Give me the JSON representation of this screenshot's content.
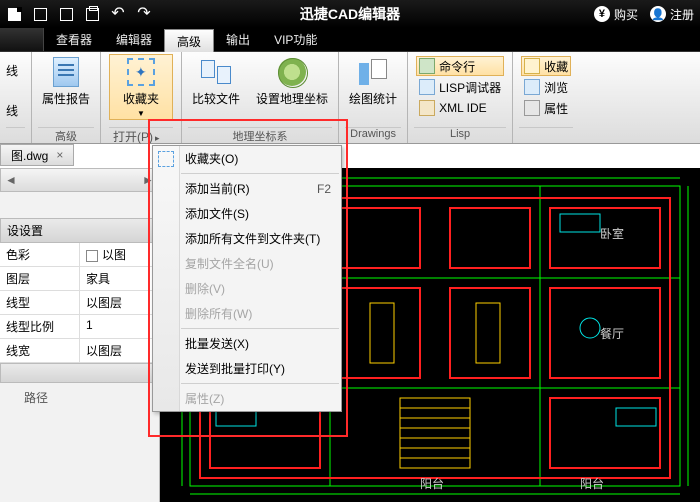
{
  "titlebar": {
    "app_name": "迅捷CAD编辑器",
    "buy": "购买",
    "register": "注册"
  },
  "tabs": {
    "viewer": "查看器",
    "editor": "编辑器",
    "advanced": "高级",
    "output": "输出",
    "vip": "VIP功能"
  },
  "ribbon": {
    "left_stub_top": "线",
    "left_stub_bot": "线",
    "group_adv": {
      "report": "属性报告",
      "foot": "高级"
    },
    "group_fav": {
      "fav": "收藏夹",
      "open": "打开(P)"
    },
    "group_geo": {
      "compare": "比较文件",
      "setgeo": "设置地理坐标",
      "foot": "地理坐标系"
    },
    "group_draw": {
      "stat": "绘图统计",
      "foot": "Drawings"
    },
    "group_lisp": {
      "cmd": "命令行",
      "lisp": "LISP调试器",
      "xml": "XML IDE",
      "foot": "Lisp"
    },
    "group_extra": {
      "col": "收藏",
      "browse": "浏览",
      "prop": "属性"
    }
  },
  "file_tab": "图.dwg",
  "panel": {
    "settings_head": "设设置",
    "rows": {
      "color_k": "色彩",
      "color_v": "以图",
      "layer_k": "图层",
      "layer_v": "家具",
      "linetype_k": "线型",
      "linetype_v": "以图层",
      "ltscale_k": "线型比例",
      "ltscale_v": "1",
      "lineweight_k": "线宽",
      "lineweight_v": "以图层"
    },
    "path": "路径"
  },
  "menu": {
    "fav": "收藏夹(O)",
    "add_current": "添加当前(R)",
    "add_current_sc": "F2",
    "add_file": "添加文件(S)",
    "add_all": "添加所有文件到文件夹(T)",
    "copy_name": "复制文件全名(U)",
    "delete": "删除(V)",
    "delete_all": "删除所有(W)",
    "batch_send": "批量发送(X)",
    "send_print": "发送到批量打印(Y)",
    "props": "属性(Z)"
  }
}
